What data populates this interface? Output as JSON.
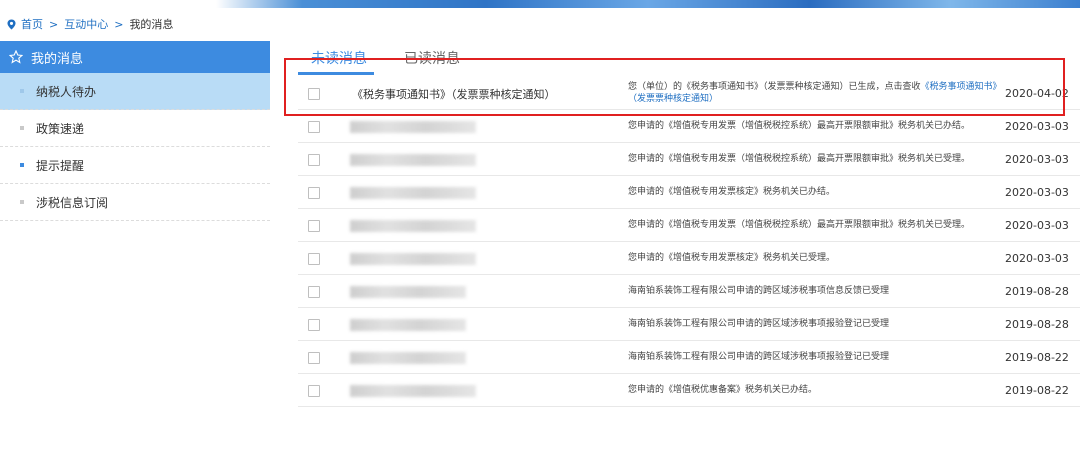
{
  "breadcrumb": {
    "home": "首页",
    "interaction": "互动中心",
    "current": "我的消息",
    "sep": ">"
  },
  "sidebar": {
    "header": "我的消息",
    "items": [
      {
        "label": "纳税人待办",
        "active": true
      },
      {
        "label": "政策速递",
        "active": false
      },
      {
        "label": "提示提醒",
        "active": false
      },
      {
        "label": "涉税信息订阅",
        "active": false
      }
    ]
  },
  "tabs": {
    "unread": "未读消息",
    "read": "已读消息"
  },
  "messages": [
    {
      "title": "《税务事项通知书》（发票票种核定通知）",
      "desc_prefix": "您（单位）的《税务事项通知书》（发票票种核定通知）已生成，点击查收",
      "desc_link": "《税务事项通知书》（发票票种核定通知）",
      "date": "2020-04-02"
    },
    {
      "title": "",
      "desc": "您申请的《增值税专用发票（增值税税控系统）最高开票限额审批》税务机关已办结。",
      "date": "2020-03-03"
    },
    {
      "title": "",
      "desc": "您申请的《增值税专用发票（增值税税控系统）最高开票限额审批》税务机关已受理。",
      "date": "2020-03-03"
    },
    {
      "title": "",
      "desc": "您申请的《增值税专用发票核定》税务机关已办结。",
      "date": "2020-03-03"
    },
    {
      "title": "",
      "desc": "您申请的《增值税专用发票（增值税税控系统）最高开票限额审批》税务机关已受理。",
      "date": "2020-03-03"
    },
    {
      "title": "",
      "desc": "您申请的《增值税专用发票核定》税务机关已受理。",
      "date": "2020-03-03"
    },
    {
      "title": "",
      "desc": "海南铂系装饰工程有限公司申请的跨区域涉税事项信息反馈已受理",
      "date": "2019-08-28"
    },
    {
      "title": "",
      "desc": "海南铂系装饰工程有限公司申请的跨区域涉税事项报验登记已受理",
      "date": "2019-08-28"
    },
    {
      "title": "",
      "desc": "海南铂系装饰工程有限公司申请的跨区域涉税事项报验登记已受理",
      "date": "2019-08-22"
    },
    {
      "title": "",
      "desc": "您申请的《增值税优惠备案》税务机关已办结。",
      "date": "2019-08-22"
    }
  ],
  "colors": {
    "accent": "#3d8be0",
    "highlight": "#e02020",
    "active_item_bg": "#b9dcf6"
  }
}
